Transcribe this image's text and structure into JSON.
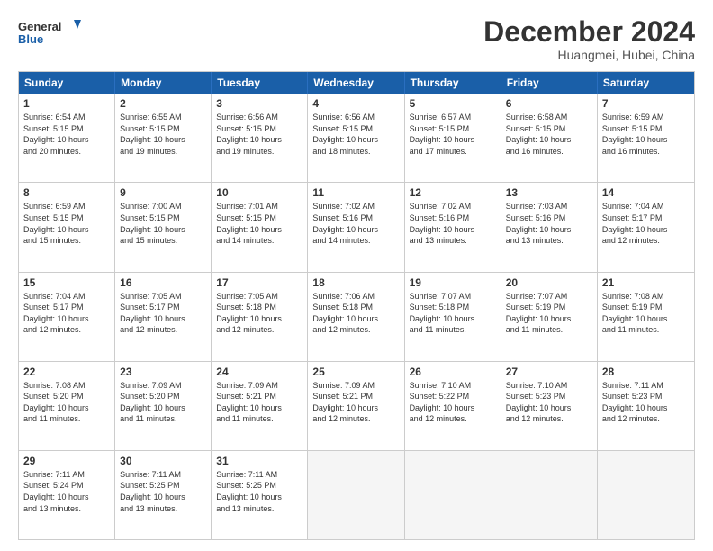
{
  "logo": {
    "line1": "General",
    "line2": "Blue"
  },
  "title": "December 2024",
  "subtitle": "Huangmei, Hubei, China",
  "days": [
    "Sunday",
    "Monday",
    "Tuesday",
    "Wednesday",
    "Thursday",
    "Friday",
    "Saturday"
  ],
  "weeks": [
    [
      {
        "day": "1",
        "text": "Sunrise: 6:54 AM\nSunset: 5:15 PM\nDaylight: 10 hours\nand 20 minutes."
      },
      {
        "day": "2",
        "text": "Sunrise: 6:55 AM\nSunset: 5:15 PM\nDaylight: 10 hours\nand 19 minutes."
      },
      {
        "day": "3",
        "text": "Sunrise: 6:56 AM\nSunset: 5:15 PM\nDaylight: 10 hours\nand 19 minutes."
      },
      {
        "day": "4",
        "text": "Sunrise: 6:56 AM\nSunset: 5:15 PM\nDaylight: 10 hours\nand 18 minutes."
      },
      {
        "day": "5",
        "text": "Sunrise: 6:57 AM\nSunset: 5:15 PM\nDaylight: 10 hours\nand 17 minutes."
      },
      {
        "day": "6",
        "text": "Sunrise: 6:58 AM\nSunset: 5:15 PM\nDaylight: 10 hours\nand 16 minutes."
      },
      {
        "day": "7",
        "text": "Sunrise: 6:59 AM\nSunset: 5:15 PM\nDaylight: 10 hours\nand 16 minutes."
      }
    ],
    [
      {
        "day": "8",
        "text": "Sunrise: 6:59 AM\nSunset: 5:15 PM\nDaylight: 10 hours\nand 15 minutes."
      },
      {
        "day": "9",
        "text": "Sunrise: 7:00 AM\nSunset: 5:15 PM\nDaylight: 10 hours\nand 15 minutes."
      },
      {
        "day": "10",
        "text": "Sunrise: 7:01 AM\nSunset: 5:15 PM\nDaylight: 10 hours\nand 14 minutes."
      },
      {
        "day": "11",
        "text": "Sunrise: 7:02 AM\nSunset: 5:16 PM\nDaylight: 10 hours\nand 14 minutes."
      },
      {
        "day": "12",
        "text": "Sunrise: 7:02 AM\nSunset: 5:16 PM\nDaylight: 10 hours\nand 13 minutes."
      },
      {
        "day": "13",
        "text": "Sunrise: 7:03 AM\nSunset: 5:16 PM\nDaylight: 10 hours\nand 13 minutes."
      },
      {
        "day": "14",
        "text": "Sunrise: 7:04 AM\nSunset: 5:17 PM\nDaylight: 10 hours\nand 12 minutes."
      }
    ],
    [
      {
        "day": "15",
        "text": "Sunrise: 7:04 AM\nSunset: 5:17 PM\nDaylight: 10 hours\nand 12 minutes."
      },
      {
        "day": "16",
        "text": "Sunrise: 7:05 AM\nSunset: 5:17 PM\nDaylight: 10 hours\nand 12 minutes."
      },
      {
        "day": "17",
        "text": "Sunrise: 7:05 AM\nSunset: 5:18 PM\nDaylight: 10 hours\nand 12 minutes."
      },
      {
        "day": "18",
        "text": "Sunrise: 7:06 AM\nSunset: 5:18 PM\nDaylight: 10 hours\nand 12 minutes."
      },
      {
        "day": "19",
        "text": "Sunrise: 7:07 AM\nSunset: 5:18 PM\nDaylight: 10 hours\nand 11 minutes."
      },
      {
        "day": "20",
        "text": "Sunrise: 7:07 AM\nSunset: 5:19 PM\nDaylight: 10 hours\nand 11 minutes."
      },
      {
        "day": "21",
        "text": "Sunrise: 7:08 AM\nSunset: 5:19 PM\nDaylight: 10 hours\nand 11 minutes."
      }
    ],
    [
      {
        "day": "22",
        "text": "Sunrise: 7:08 AM\nSunset: 5:20 PM\nDaylight: 10 hours\nand 11 minutes."
      },
      {
        "day": "23",
        "text": "Sunrise: 7:09 AM\nSunset: 5:20 PM\nDaylight: 10 hours\nand 11 minutes."
      },
      {
        "day": "24",
        "text": "Sunrise: 7:09 AM\nSunset: 5:21 PM\nDaylight: 10 hours\nand 11 minutes."
      },
      {
        "day": "25",
        "text": "Sunrise: 7:09 AM\nSunset: 5:21 PM\nDaylight: 10 hours\nand 12 minutes."
      },
      {
        "day": "26",
        "text": "Sunrise: 7:10 AM\nSunset: 5:22 PM\nDaylight: 10 hours\nand 12 minutes."
      },
      {
        "day": "27",
        "text": "Sunrise: 7:10 AM\nSunset: 5:23 PM\nDaylight: 10 hours\nand 12 minutes."
      },
      {
        "day": "28",
        "text": "Sunrise: 7:11 AM\nSunset: 5:23 PM\nDaylight: 10 hours\nand 12 minutes."
      }
    ],
    [
      {
        "day": "29",
        "text": "Sunrise: 7:11 AM\nSunset: 5:24 PM\nDaylight: 10 hours\nand 13 minutes."
      },
      {
        "day": "30",
        "text": "Sunrise: 7:11 AM\nSunset: 5:25 PM\nDaylight: 10 hours\nand 13 minutes."
      },
      {
        "day": "31",
        "text": "Sunrise: 7:11 AM\nSunset: 5:25 PM\nDaylight: 10 hours\nand 13 minutes."
      },
      {
        "day": "",
        "text": ""
      },
      {
        "day": "",
        "text": ""
      },
      {
        "day": "",
        "text": ""
      },
      {
        "day": "",
        "text": ""
      }
    ]
  ]
}
